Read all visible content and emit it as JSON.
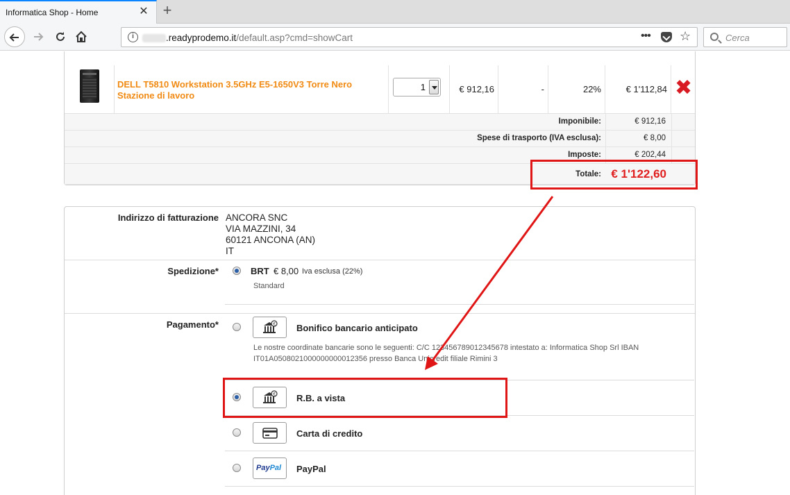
{
  "browser": {
    "tab_title": "Informatica Shop - Home",
    "tab_close": "✕",
    "new_tab": "+",
    "url_domain": ".readyprodemo.it",
    "url_path": "/default.asp?cmd=showCart",
    "url_menu": "•••",
    "search_placeholder": "Cerca"
  },
  "cart": {
    "product": {
      "name": "DELL T5810 Workstation 3.5GHz E5-1650V3 Torre Nero Stazione di lavoro",
      "quantity": "1",
      "unit_price": "€ 912,16",
      "discount": "-",
      "vat": "22%",
      "total": "€ 1'112,84"
    },
    "summary": {
      "taxable_label": "Imponibile:",
      "taxable_value": "€ 912,16",
      "shipping_label": "Spese di trasporto (IVA esclusa):",
      "shipping_value": "€ 8,00",
      "tax_label": "Imposte:",
      "tax_value": "€ 202,44",
      "total_label": "Totale:",
      "total_value": "€ 1'122,60"
    }
  },
  "checkout": {
    "billing_label": "Indirizzo di fatturazione",
    "billing_address": [
      "ANCORA SNC",
      "VIA MAZZINI, 34",
      "60121 ANCONA (AN)",
      "IT"
    ],
    "shipping_label": "Spedizione*",
    "shipping_option": {
      "name": "BRT",
      "price": "€ 8,00",
      "note": "Iva esclusa (22%)",
      "description": "Standard"
    },
    "payment_label": "Pagamento*",
    "payment_options": [
      {
        "name": "Bonifico bancario anticipato",
        "description_line1": "Le nostre coordinate bancarie sono le seguenti: C/C 123456789012345678 intestato a: Informatica Shop Srl IBAN",
        "description_line2": "IT01A0508021000000000012356 presso Banca Unicredit filiale Rimini 3",
        "icon": "bank-icon",
        "selected": false
      },
      {
        "name": "R.B. a vista",
        "icon": "bank-icon",
        "selected": true
      },
      {
        "name": "Carta di credito",
        "icon": "credit-card-icon",
        "selected": false
      },
      {
        "name": "PayPal",
        "icon": "paypal-logo",
        "selected": false
      }
    ]
  },
  "colors": {
    "product_link": "#f08a12",
    "total_red": "#e02020",
    "annotation_red": "#e01515",
    "delete_red": "#d81b22"
  }
}
